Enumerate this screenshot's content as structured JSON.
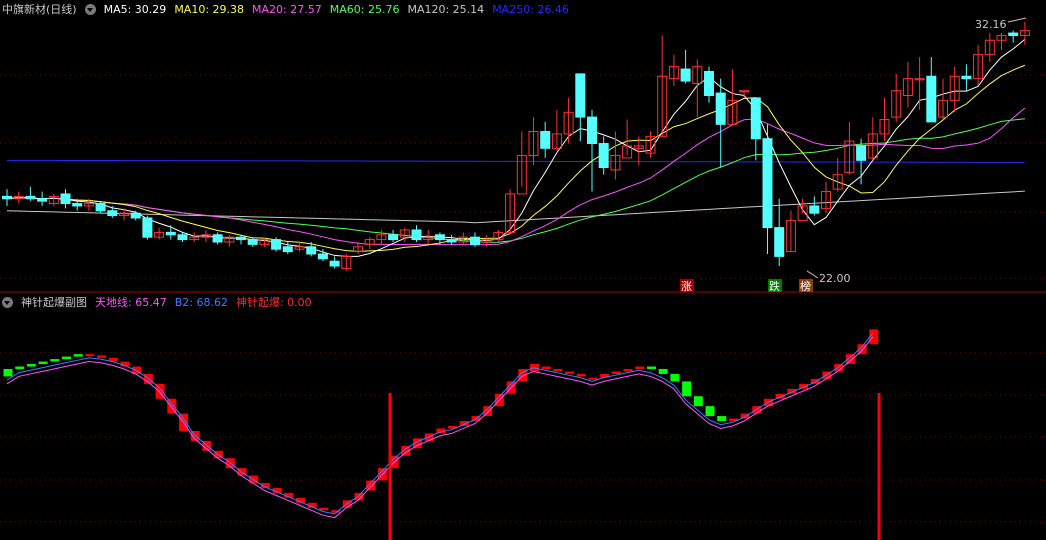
{
  "main_header": {
    "stock_name": "中旗新材(日线)",
    "indicators": [
      {
        "label": "MA5: 30.29",
        "color": "#ffffff"
      },
      {
        "label": "MA10: 29.38",
        "color": "#ffff54"
      },
      {
        "label": "MA20: 27.57",
        "color": "#ff54ff"
      },
      {
        "label": "MA60: 25.76",
        "color": "#54ff54"
      },
      {
        "label": "MA120: 25.14",
        "color": "#c8c8c8"
      },
      {
        "label": "MA250: 26.46",
        "color": "#2828ff"
      }
    ]
  },
  "sub_header": {
    "title": "神针起爆副图",
    "indicators": [
      {
        "label": "天地线: 65.47",
        "color": "#ff54ff"
      },
      {
        "label": "B2: 68.62",
        "color": "#3a7dff"
      },
      {
        "label": "神针起爆: 0.00",
        "color": "#ff2b2b"
      }
    ]
  },
  "annotations": {
    "high_price": "32.16",
    "low_price": "22.00",
    "badge_zhang": "涨",
    "badge_die": "跌",
    "badge_bang": "榜"
  },
  "colors": {
    "up": "#ff3232",
    "down": "#54ffff",
    "bar_up": "#ff0000",
    "bar_down": "#00ff00",
    "grid": "#8b0000"
  },
  "chart_data": {
    "type": "candlestick",
    "price_range": [
      22.0,
      32.16
    ],
    "candles": [
      [
        24.9,
        24.8,
        25.2,
        24.5
      ],
      [
        24.8,
        24.9,
        25.1,
        24.6
      ],
      [
        24.9,
        24.8,
        25.3,
        24.7
      ],
      [
        24.8,
        24.7,
        25.1,
        24.5
      ],
      [
        24.6,
        24.9,
        25.0,
        24.5
      ],
      [
        25.0,
        24.6,
        25.2,
        24.4
      ],
      [
        24.6,
        24.5,
        24.8,
        24.3
      ],
      [
        24.5,
        24.6,
        24.8,
        24.3
      ],
      [
        24.6,
        24.3,
        24.7,
        24.2
      ],
      [
        24.3,
        24.1,
        24.5,
        24.0
      ],
      [
        24.1,
        24.2,
        24.4,
        23.9
      ],
      [
        24.2,
        24.0,
        24.3,
        23.9
      ],
      [
        24.0,
        23.2,
        24.1,
        23.1
      ],
      [
        23.2,
        23.4,
        23.6,
        23.1
      ],
      [
        23.4,
        23.3,
        23.7,
        23.1
      ],
      [
        23.3,
        23.1,
        23.4,
        23.0
      ],
      [
        23.1,
        23.2,
        23.4,
        23.0
      ],
      [
        23.2,
        23.3,
        23.5,
        23.0
      ],
      [
        23.3,
        23.0,
        23.4,
        22.9
      ],
      [
        23.0,
        23.2,
        23.3,
        22.8
      ],
      [
        23.2,
        23.1,
        23.3,
        22.9
      ],
      [
        23.1,
        22.9,
        23.2,
        22.8
      ],
      [
        22.9,
        23.1,
        23.2,
        22.8
      ],
      [
        23.1,
        22.7,
        23.2,
        22.6
      ],
      [
        22.8,
        22.6,
        23.0,
        22.5
      ],
      [
        22.7,
        22.8,
        23.0,
        22.6
      ],
      [
        22.8,
        22.5,
        23.0,
        22.4
      ],
      [
        22.5,
        22.3,
        22.7,
        22.2
      ],
      [
        22.2,
        22.0,
        22.4,
        21.9
      ],
      [
        21.9,
        22.4,
        22.5,
        21.8
      ],
      [
        22.6,
        22.8,
        23.0,
        22.5
      ],
      [
        22.9,
        23.1,
        23.2,
        22.7
      ],
      [
        23.1,
        23.3,
        23.5,
        22.9
      ],
      [
        23.3,
        23.1,
        23.5,
        23.0
      ],
      [
        23.2,
        23.5,
        23.6,
        23.0
      ],
      [
        23.5,
        23.1,
        23.7,
        23.0
      ],
      [
        23.1,
        23.2,
        23.5,
        22.9
      ],
      [
        23.3,
        23.1,
        23.4,
        22.9
      ],
      [
        23.1,
        23.0,
        23.3,
        22.9
      ],
      [
        23.0,
        23.2,
        23.4,
        22.9
      ],
      [
        23.2,
        22.9,
        23.4,
        22.8
      ],
      [
        23.0,
        23.1,
        23.3,
        22.8
      ],
      [
        23.1,
        23.4,
        23.5,
        23.0
      ],
      [
        23.4,
        25.0,
        25.2,
        23.3
      ],
      [
        25.0,
        26.6,
        27.6,
        25.3
      ],
      [
        26.6,
        27.6,
        28.2,
        26.2
      ],
      [
        27.6,
        26.9,
        28.0,
        26.5
      ],
      [
        26.9,
        27.5,
        28.5,
        26.8
      ],
      [
        27.5,
        28.4,
        29.0,
        27.1
      ],
      [
        30.0,
        28.2,
        30.0,
        27.2
      ],
      [
        28.2,
        27.1,
        28.5,
        25.1
      ],
      [
        27.1,
        26.1,
        27.4,
        25.8
      ],
      [
        26.0,
        26.6,
        27.6,
        25.6
      ],
      [
        26.5,
        27.0,
        28.1,
        26.6
      ],
      [
        26.9,
        27.0,
        27.4,
        26.2
      ],
      [
        26.7,
        27.4,
        27.6,
        26.5
      ],
      [
        27.4,
        29.9,
        31.6,
        27.4
      ],
      [
        29.8,
        30.3,
        30.8,
        29.5
      ],
      [
        30.2,
        29.7,
        31.0,
        29.6
      ],
      [
        29.6,
        30.3,
        30.6,
        28.2
      ],
      [
        30.1,
        29.1,
        30.3,
        28.8
      ],
      [
        29.2,
        27.9,
        29.8,
        26.1
      ],
      [
        27.9,
        28.9,
        30.2,
        27.9
      ],
      [
        29.3,
        29.3,
        29.3,
        29.0
      ],
      [
        29.0,
        27.3,
        29.0,
        26.4
      ],
      [
        27.3,
        23.6,
        27.9,
        22.5
      ],
      [
        23.6,
        22.4,
        24.8,
        22.0
      ],
      [
        22.6,
        23.9,
        24.3,
        22.6
      ],
      [
        23.9,
        24.5,
        24.8,
        24.2
      ],
      [
        24.5,
        24.2,
        24.9,
        24.1
      ],
      [
        24.4,
        25.1,
        25.5,
        24.2
      ],
      [
        25.2,
        25.8,
        26.5,
        25.1
      ],
      [
        25.9,
        27.2,
        28.0,
        25.8
      ],
      [
        27.0,
        26.4,
        27.3,
        25.4
      ],
      [
        26.5,
        27.5,
        28.2,
        26.4
      ],
      [
        27.5,
        28.1,
        29.0,
        27.2
      ],
      [
        28.2,
        29.3,
        30.0,
        28.0
      ],
      [
        29.1,
        29.8,
        30.5,
        28.6
      ],
      [
        29.8,
        29.8,
        30.7,
        28.5
      ],
      [
        29.9,
        28.0,
        30.7,
        28.0
      ],
      [
        28.2,
        28.9,
        29.8,
        28.1
      ],
      [
        28.9,
        29.9,
        30.3,
        28.4
      ],
      [
        29.9,
        29.8,
        30.4,
        29.3
      ],
      [
        29.8,
        30.8,
        31.2,
        29.5
      ],
      [
        30.8,
        31.4,
        31.7,
        30.5
      ],
      [
        31.4,
        31.6,
        31.7,
        31.0
      ],
      [
        31.7,
        31.6,
        31.8,
        31.3
      ],
      [
        31.6,
        31.8,
        32.16,
        31.2
      ]
    ],
    "sub_range": [
      10,
      100
    ],
    "sub_bars": [
      [
        42,
        39
      ],
      [
        43,
        42
      ],
      [
        44,
        43
      ],
      [
        45,
        44
      ],
      [
        46,
        45
      ],
      [
        47,
        46
      ],
      [
        48,
        47
      ],
      [
        47.5,
        48
      ],
      [
        46.5,
        47.5
      ],
      [
        45,
        46.5
      ],
      [
        43,
        45
      ],
      [
        40,
        43
      ],
      [
        36,
        40
      ],
      [
        30,
        36
      ],
      [
        24,
        30
      ],
      [
        17,
        24
      ],
      [
        13,
        17
      ],
      [
        9,
        13
      ],
      [
        6,
        9
      ],
      [
        2,
        6
      ],
      [
        -1,
        2
      ],
      [
        -4,
        -1
      ],
      [
        -6,
        -4
      ],
      [
        -8,
        -6
      ],
      [
        -10,
        -8
      ],
      [
        -12,
        -10
      ],
      [
        -14,
        -12
      ],
      [
        -15,
        -14
      ],
      [
        -16,
        -15
      ],
      [
        -14,
        -11
      ],
      [
        -11,
        -8
      ],
      [
        -7,
        -3
      ],
      [
        -3,
        2
      ],
      [
        2,
        7
      ],
      [
        7,
        11
      ],
      [
        10,
        14
      ],
      [
        13,
        16
      ],
      [
        16,
        18
      ],
      [
        18,
        19
      ],
      [
        19,
        21
      ],
      [
        21,
        23
      ],
      [
        23,
        27
      ],
      [
        27,
        32
      ],
      [
        32,
        37
      ],
      [
        37,
        42
      ],
      [
        41,
        44
      ],
      [
        42,
        43
      ],
      [
        41,
        42
      ],
      [
        40,
        41
      ],
      [
        39,
        40
      ],
      [
        38,
        38.5
      ],
      [
        38.5,
        40
      ],
      [
        40,
        41
      ],
      [
        41,
        42
      ],
      [
        42,
        43
      ],
      [
        43,
        42
      ],
      [
        42,
        40
      ],
      [
        40,
        37
      ],
      [
        37,
        31
      ],
      [
        31,
        27
      ],
      [
        27,
        23
      ],
      [
        23,
        21
      ],
      [
        21,
        22
      ],
      [
        22,
        24
      ],
      [
        24,
        27
      ],
      [
        27,
        30
      ],
      [
        30,
        32
      ],
      [
        32,
        34
      ],
      [
        34,
        36
      ],
      [
        36,
        38
      ],
      [
        38,
        41
      ],
      [
        41,
        44
      ],
      [
        44,
        48
      ],
      [
        48,
        52
      ],
      [
        52,
        58
      ]
    ]
  }
}
